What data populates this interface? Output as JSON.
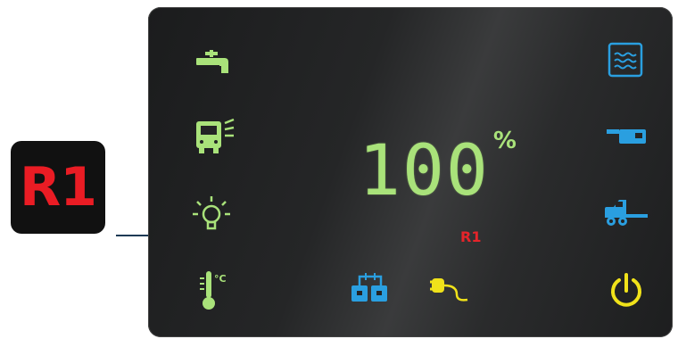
{
  "callout": {
    "label": "R1"
  },
  "display": {
    "value": "100",
    "unit": "%",
    "sub_label": "R1"
  },
  "colors": {
    "green": "#a9e27a",
    "blue": "#2a9fe0",
    "yellow": "#f0e21a",
    "red": "#e5242a",
    "panel": "#232425"
  },
  "icons": {
    "left": [
      "water-tap-icon",
      "vehicle-lights-icon",
      "light-bulb-icon",
      "thermometer-icon"
    ],
    "right": [
      "water-tank-icon",
      "trailer-icon",
      "tow-vehicle-icon",
      "power-icon"
    ],
    "bottom": [
      "tank-connection-icon",
      "shore-power-plug-icon"
    ]
  }
}
